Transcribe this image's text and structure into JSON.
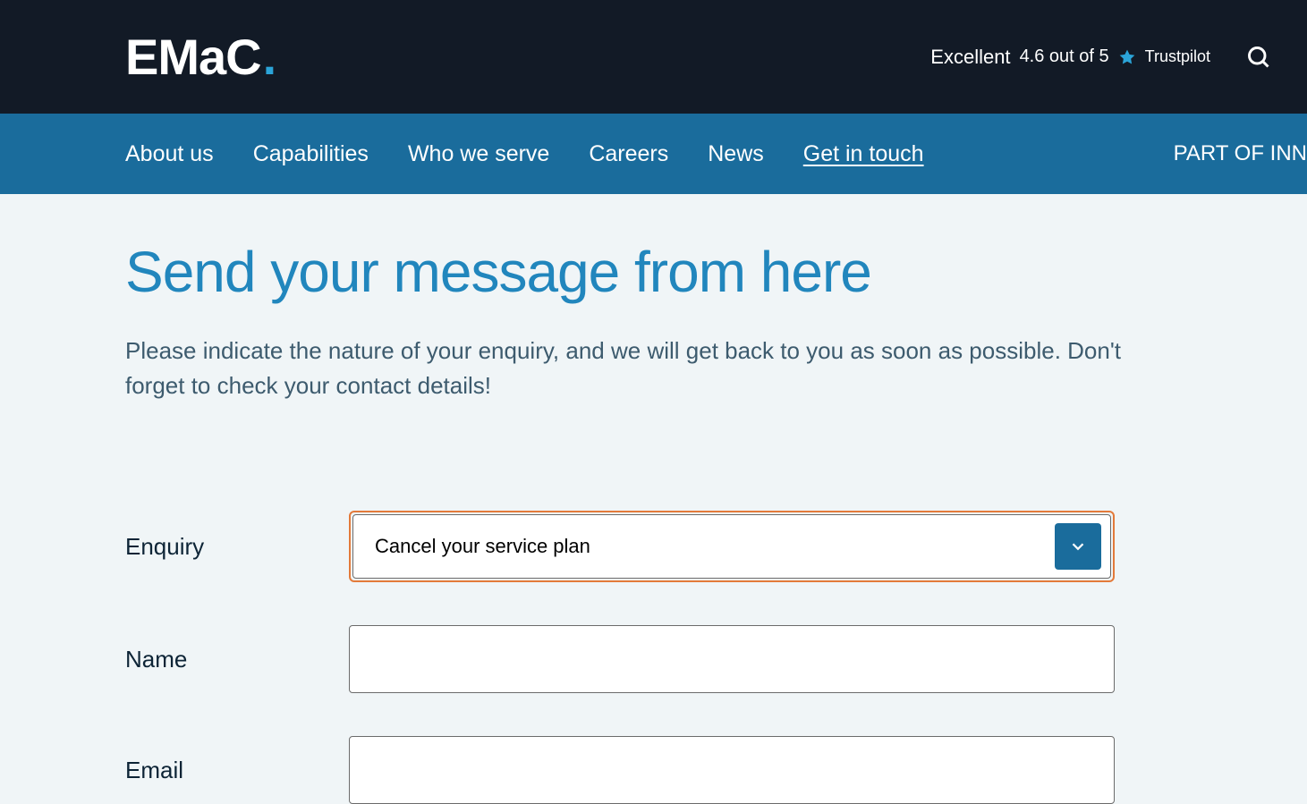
{
  "header": {
    "logo_text": "EMaC",
    "logo_dot": ".",
    "trustpilot": {
      "rating_label": "Excellent",
      "score_text": "4.6 out of 5",
      "brand": "Trustpilot"
    }
  },
  "nav": {
    "items": [
      {
        "label": "About us",
        "active": false
      },
      {
        "label": "Capabilities",
        "active": false
      },
      {
        "label": "Who we serve",
        "active": false
      },
      {
        "label": "Careers",
        "active": false
      },
      {
        "label": "News",
        "active": false
      },
      {
        "label": "Get in touch",
        "active": true
      }
    ],
    "right_text": "PART OF INN"
  },
  "page": {
    "title": "Send your message from here",
    "subtitle": "Please indicate the nature of your enquiry, and we will get back to you as soon as possible. Don't forget to check your contact details!"
  },
  "form": {
    "enquiry": {
      "label": "Enquiry",
      "selected": "Cancel your service plan"
    },
    "name": {
      "label": "Name",
      "value": ""
    },
    "email": {
      "label": "Email",
      "value": ""
    }
  }
}
